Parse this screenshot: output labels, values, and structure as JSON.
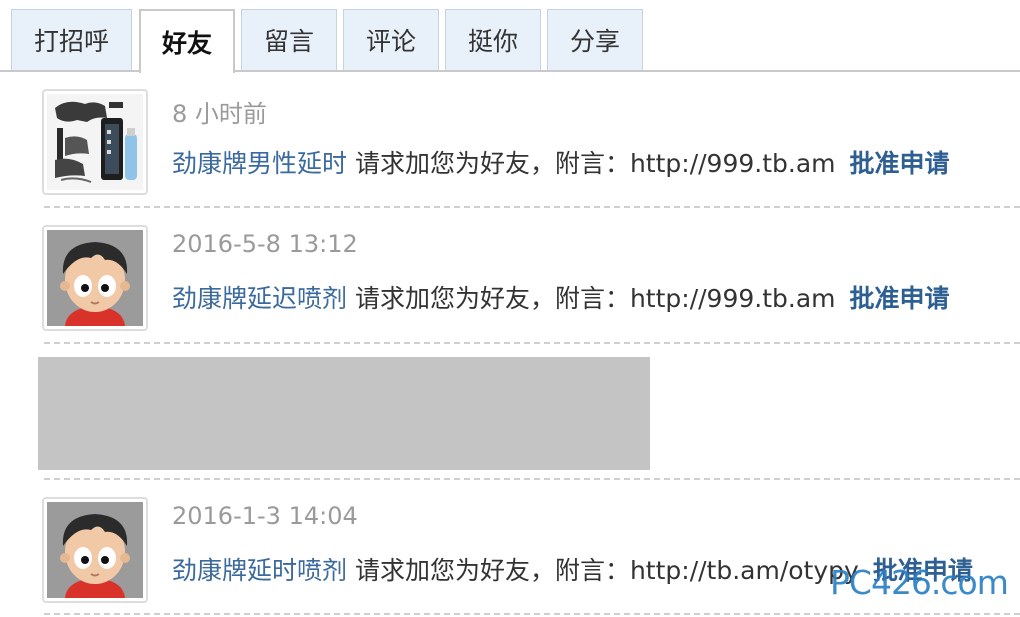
{
  "tabs": [
    {
      "label": "打招呼"
    },
    {
      "label": "好友"
    },
    {
      "label": "留言"
    },
    {
      "label": "评论"
    },
    {
      "label": "挺你"
    },
    {
      "label": "分享"
    }
  ],
  "active_tab": "好友",
  "feed": [
    {
      "avatar_icon": "product-thumbnail-icon",
      "time": "8 小时前",
      "user": "劲康牌男性延时",
      "message": " 请求加您为好友，附言：http://999.tb.am",
      "action": "批准申请"
    },
    {
      "avatar_icon": "cartoon-boy-avatar-icon",
      "time": "2016-5-8 13:12",
      "user": "劲康牌延迟喷剂",
      "message": " 请求加您为好友，附言：http://999.tb.am",
      "action": "批准申请"
    },
    {
      "avatar_icon": "cartoon-boy-avatar-icon",
      "time": "2016-1-3 14:04",
      "user": "劲康牌延时喷剂",
      "message": " 请求加您为好友，附言：http://tb.am/otypy",
      "action": "批准申请"
    }
  ],
  "watermark": "PC426.com",
  "colors": {
    "tab_background": "#e8f1fa",
    "link": "#3b6a9e",
    "action": "#2d5f93",
    "timestamp": "#9a9a9a",
    "placeholder": "#c4c4c4"
  }
}
